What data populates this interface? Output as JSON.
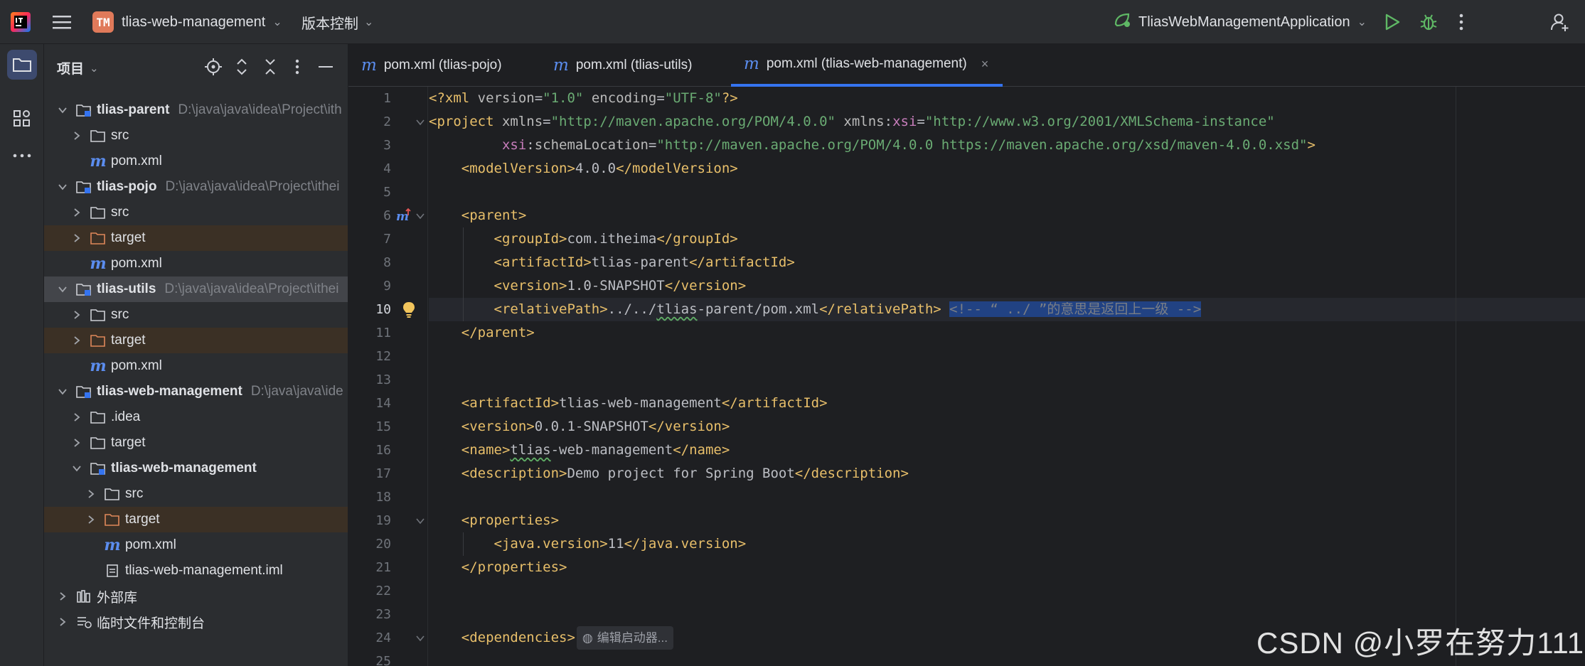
{
  "titlebar": {
    "project_badge": "TM",
    "project_name": "tlias-web-management",
    "vcs_label": "版本控制",
    "run_config": "TliasWebManagementApplication"
  },
  "project_panel": {
    "title": "项目",
    "tree": [
      {
        "name": "tlias-parent",
        "path": "D:\\java\\java\\idea\\Project\\ith",
        "type": "module",
        "expanded": true,
        "bold": true
      },
      {
        "name": "src",
        "type": "folder",
        "expanded": false
      },
      {
        "name": "pom.xml",
        "type": "maven"
      },
      {
        "name": "tlias-pojo",
        "path": "D:\\java\\java\\idea\\Project\\ithei",
        "type": "module",
        "expanded": true,
        "bold": true
      },
      {
        "name": "src",
        "type": "folder",
        "expanded": false
      },
      {
        "name": "target",
        "type": "excluded-folder",
        "expanded": false
      },
      {
        "name": "pom.xml",
        "type": "maven"
      },
      {
        "name": "tlias-utils",
        "path": "D:\\java\\java\\idea\\Project\\ithei",
        "type": "module",
        "expanded": true,
        "bold": true,
        "selected": true
      },
      {
        "name": "src",
        "type": "folder",
        "expanded": false
      },
      {
        "name": "target",
        "type": "excluded-folder",
        "expanded": false
      },
      {
        "name": "pom.xml",
        "type": "maven"
      },
      {
        "name": "tlias-web-management",
        "path": "D:\\java\\java\\ide",
        "type": "module",
        "expanded": true,
        "bold": true
      },
      {
        "name": ".idea",
        "type": "folder",
        "expanded": false
      },
      {
        "name": "target",
        "type": "folder",
        "expanded": false
      },
      {
        "name": "tlias-web-management",
        "type": "module",
        "expanded": true,
        "bold": true
      },
      {
        "name": "src",
        "type": "folder",
        "expanded": false
      },
      {
        "name": "target",
        "type": "excluded-folder",
        "expanded": false
      },
      {
        "name": "pom.xml",
        "type": "maven"
      },
      {
        "name": "tlias-web-management.iml",
        "type": "iml"
      },
      {
        "name": "外部库",
        "type": "library",
        "expanded": false
      },
      {
        "name": "临时文件和控制台",
        "type": "scratches",
        "expanded": false
      }
    ]
  },
  "tabs": [
    {
      "label": "pom.xml (tlias-pojo)",
      "active": false
    },
    {
      "label": "pom.xml (tlias-utils)",
      "active": false
    },
    {
      "label": "pom.xml (tlias-web-management)",
      "active": true,
      "close": "×"
    }
  ],
  "editor": {
    "current_line": 10,
    "line_numbers": [
      "1",
      "2",
      "3",
      "4",
      "5",
      "6",
      "7",
      "8",
      "9",
      "10",
      "11",
      "12",
      "13",
      "14",
      "15",
      "16",
      "17",
      "18",
      "19",
      "20",
      "21",
      "22",
      "23",
      "24",
      "25"
    ],
    "inline_hint": "编辑启动器..."
  },
  "colors": {
    "accent": "#3574f0",
    "tag": "#e8bf6a",
    "string": "#6aab73",
    "namespace": "#c77dbb",
    "maven_icon": "#5b8def"
  },
  "watermark": "CSDN @小罗在努力111"
}
